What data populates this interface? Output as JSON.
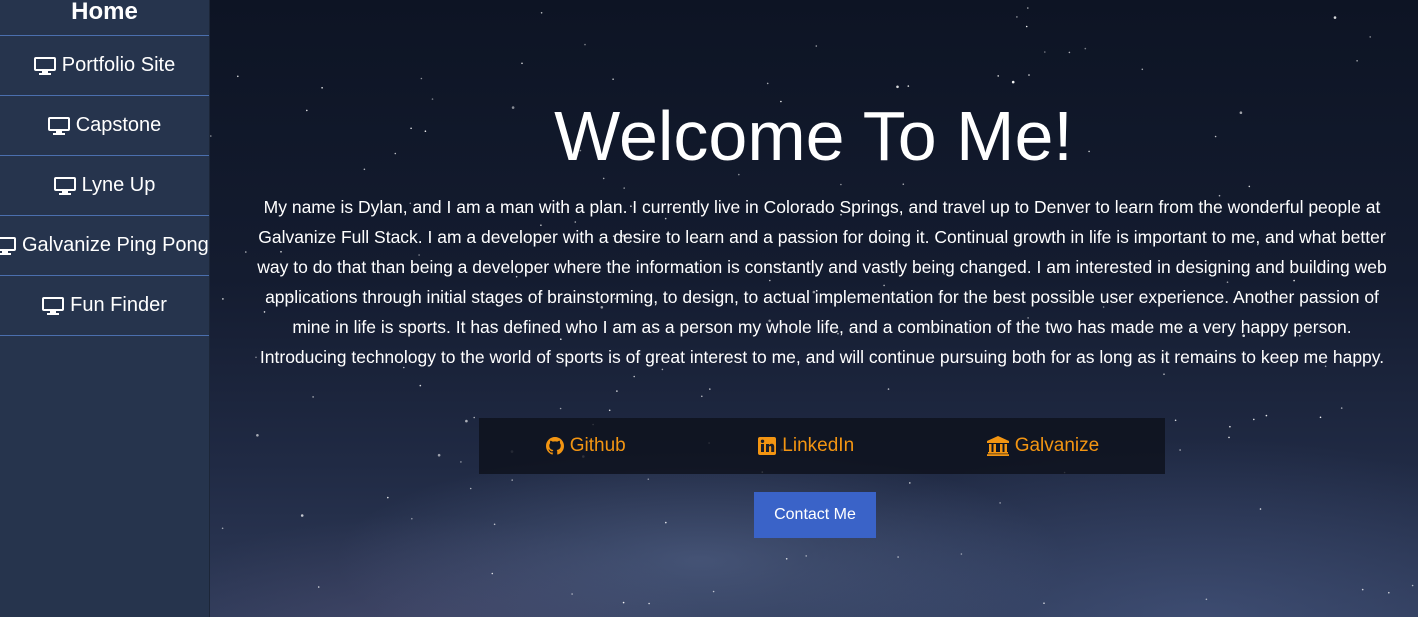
{
  "sidebar": {
    "home_label": "Home",
    "items": [
      {
        "label": "Portfolio Site",
        "icon": "desktop-icon"
      },
      {
        "label": "Capstone",
        "icon": "desktop-icon"
      },
      {
        "label": "Lyne Up",
        "icon": "desktop-icon"
      },
      {
        "label": "Galvanize Ping Pong",
        "icon": "desktop-icon"
      },
      {
        "label": "Fun Finder",
        "icon": "desktop-icon"
      }
    ]
  },
  "main": {
    "title": "Welcome To Me!",
    "bio": "My name is Dylan, and I am a man with a plan. I currently live in Colorado Springs, and travel up to Denver to learn from the wonderful people at Galvanize Full Stack. I am a developer with a desire to learn and a passion for doing it. Continual growth in life is important to me, and what better way to do that than being a developer where the information is constantly and vastly being changed. I am interested in designing and building web applications through initial stages of brainstorming, to design, to actual implementation for the best possible user experience. Another passion of mine in life is sports. It has defined who I am as a person my whole life, and a combination of the two has made me a very happy person. Introducing technology to the world of sports is of great interest to me, and will continue pursuing both for as long as it remains to keep me happy.",
    "links": [
      {
        "label": "Github",
        "icon": "github-icon"
      },
      {
        "label": "LinkedIn",
        "icon": "linkedin-icon"
      },
      {
        "label": "Galvanize",
        "icon": "institution-icon"
      }
    ],
    "contact_label": "Contact Me"
  },
  "colors": {
    "sidebar_bg": "#26344d",
    "sidebar_divider": "#4b6fae",
    "link_accent": "#f39512",
    "button_bg": "#3a63c8"
  }
}
